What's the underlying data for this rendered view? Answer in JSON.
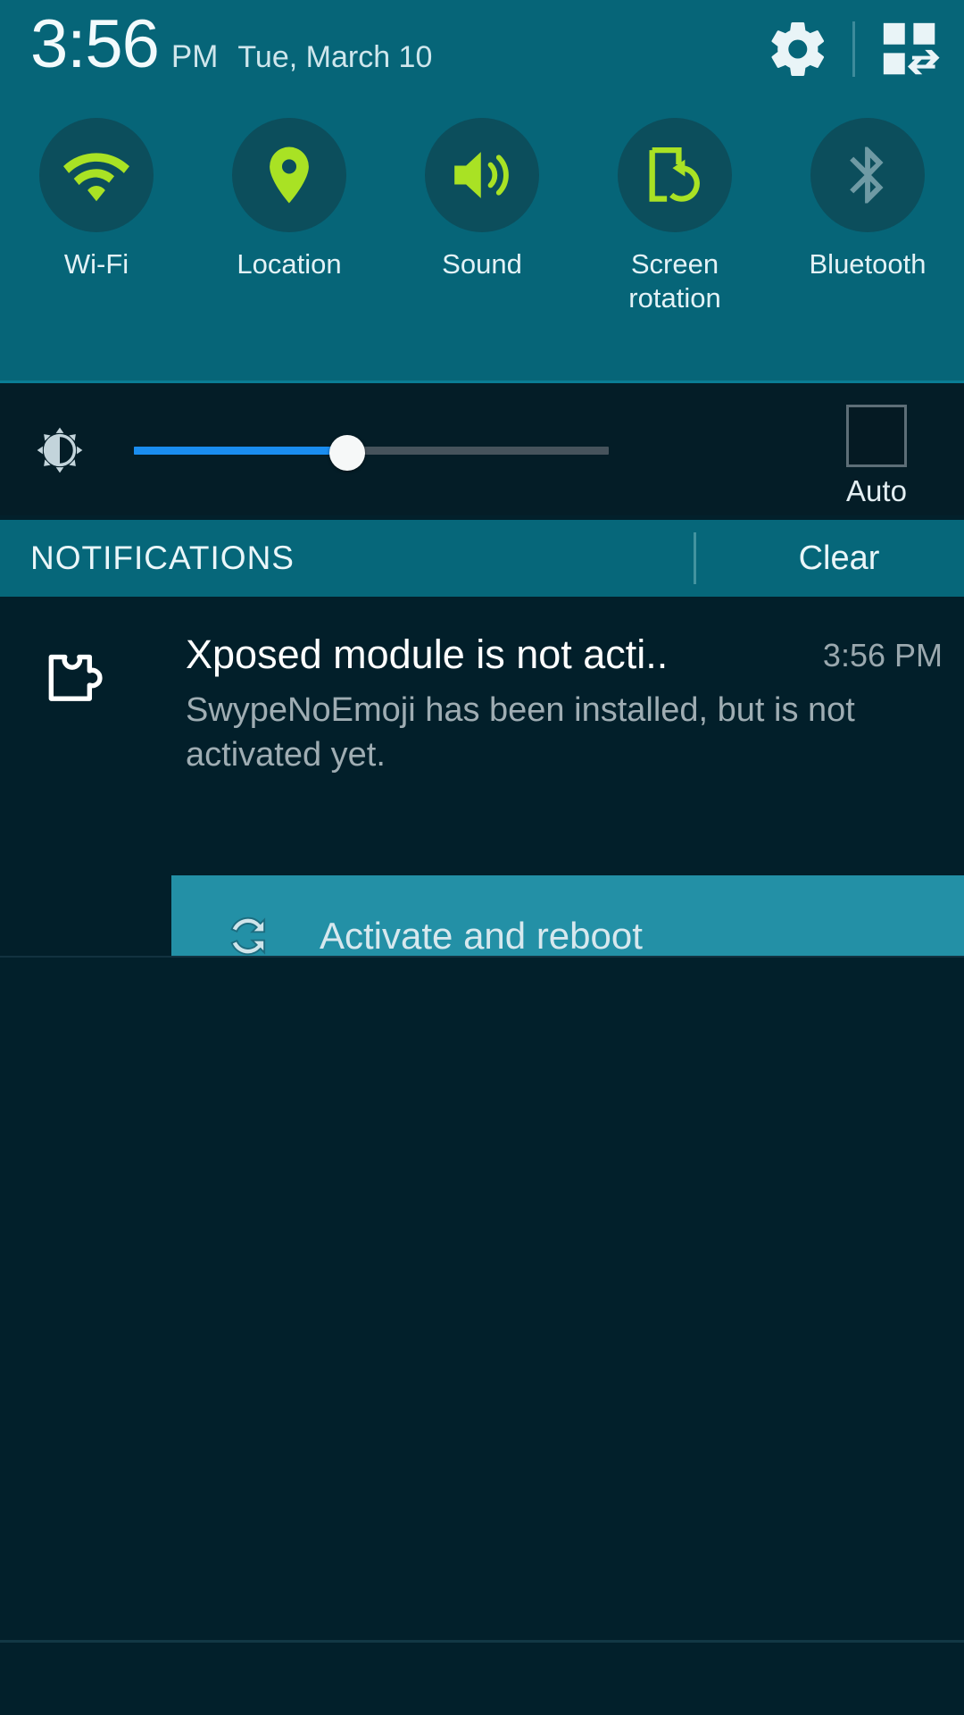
{
  "status_bar": {
    "time": "3:56",
    "ampm": "PM",
    "date": "Tue, March 10",
    "settings_icon": "gear-icon",
    "quick_toggle_icon": "quick-settings-grid-icon"
  },
  "quick_settings": {
    "toggles": [
      {
        "label": "Wi-Fi",
        "icon": "wifi-icon",
        "state": "on"
      },
      {
        "label": "Location",
        "icon": "location-pin-icon",
        "state": "on"
      },
      {
        "label": "Sound",
        "icon": "sound-volume-icon",
        "state": "on"
      },
      {
        "label": "Screen rotation",
        "icon": "screen-rotation-icon",
        "state": "on"
      },
      {
        "label": "Bluetooth",
        "icon": "bluetooth-icon",
        "state": "off"
      }
    ],
    "colors": {
      "panel_background": "#066578",
      "toggle_circle": "#0c4e5c",
      "icon_on": "#a9e224",
      "icon_off": "#6f9aa4",
      "label": "#e3f2f6"
    }
  },
  "brightness": {
    "icon": "brightness-icon",
    "value_percent": 45,
    "fill_color": "#1a8df0",
    "track_color": "#46535c",
    "auto_label": "Auto",
    "auto_checked": false
  },
  "notifications_header": {
    "title": "NOTIFICATIONS",
    "clear_label": "Clear",
    "background": "#06677a"
  },
  "notification": {
    "icon": "xposed-puzzle-icon",
    "heading": "Xposed module is not acti..",
    "time": "3:56 PM",
    "text": "SwypeNoEmoji has been installed, but is not activated yet.",
    "action": {
      "label": "Activate and reboot",
      "icon": "refresh-sync-icon",
      "background": "#2390a6",
      "pressed": true
    }
  }
}
